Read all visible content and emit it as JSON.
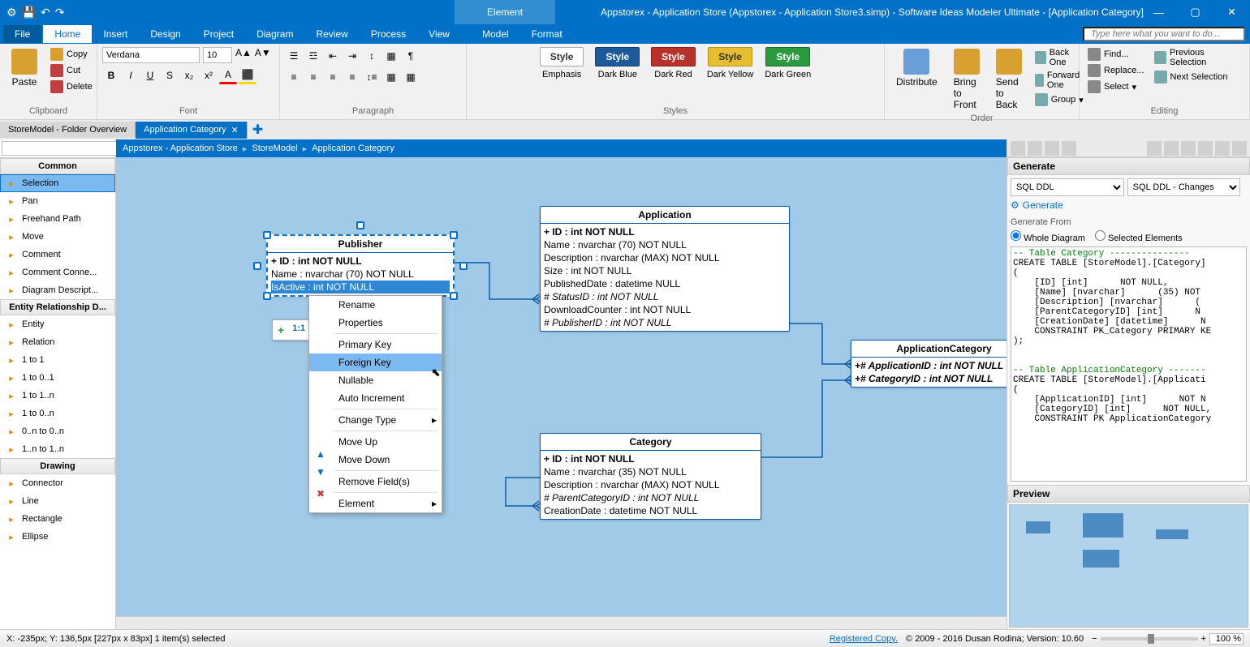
{
  "titlebar": {
    "context_tab": "Element",
    "title": "Appstorex - Application Store (Appstorex - Application Store3.simp)  - Software Ideas Modeler Ultimate - [Application Category]"
  },
  "menubar": {
    "file": "File",
    "tabs": [
      "Home",
      "Insert",
      "Design",
      "Project",
      "Diagram",
      "Review",
      "Process",
      "View",
      "Model",
      "Format"
    ],
    "active_tab": "Home",
    "search_placeholder": "Type here what you want to do..."
  },
  "ribbon": {
    "clipboard": {
      "paste": "Paste",
      "copy": "Copy",
      "cut": "Cut",
      "delete": "Delete",
      "label": "Clipboard"
    },
    "font": {
      "family": "Verdana",
      "size": "10",
      "label": "Font"
    },
    "paragraph": {
      "label": "Paragraph"
    },
    "styles": {
      "label": "Styles",
      "items": [
        {
          "name": "Emphasis",
          "btn": "Style",
          "bg": "#ffffff",
          "fg": "#333",
          "border": "#aaa"
        },
        {
          "name": "Dark Blue",
          "btn": "Style",
          "bg": "#1d5a9a",
          "fg": "#fff",
          "border": "#0e3f6f"
        },
        {
          "name": "Dark Red",
          "btn": "Style",
          "bg": "#b8312a",
          "fg": "#fff",
          "border": "#8a201a"
        },
        {
          "name": "Dark Yellow",
          "btn": "Style",
          "bg": "#e7bf2e",
          "fg": "#333",
          "border": "#b89218"
        },
        {
          "name": "Dark Green",
          "btn": "Style",
          "bg": "#2a9a3e",
          "fg": "#fff",
          "border": "#1a6e28"
        }
      ]
    },
    "order": {
      "label": "Order",
      "distribute": "Distribute",
      "bring_front": "Bring to Front",
      "send_back": "Send to Back",
      "back_one": "Back One",
      "forward_one": "Forward One",
      "group": "Group"
    },
    "editing": {
      "label": "Editing",
      "find": "Find...",
      "replace": "Replace...",
      "select": "Select",
      "prev_sel": "Previous Selection",
      "next_sel": "Next Selection"
    }
  },
  "doc_tabs": {
    "tab1": "StoreModel - Folder Overview",
    "tab2": "Application Category"
  },
  "breadcrumb": {
    "a": "Appstorex - Application Store",
    "b": "StoreModel",
    "c": "Application Category"
  },
  "left": {
    "cat_common": "Common",
    "common_items": [
      "Selection",
      "Pan",
      "Freehand Path",
      "Move",
      "Comment",
      "Comment Conne...",
      "Diagram Descript..."
    ],
    "cat_erd": "Entity Relationship D...",
    "erd_items": [
      "Entity",
      "Relation",
      "1 to 1",
      "1 to 0..1",
      "1 to 1..n",
      "1 to 0..n",
      "0..n to 0..n",
      "1..n to 1..n"
    ],
    "cat_drawing": "Drawing",
    "drawing_items": [
      "Connector",
      "Line",
      "Rectangle",
      "Ellipse"
    ]
  },
  "entities": {
    "publisher": {
      "name": "Publisher",
      "rows": [
        "+ ID : int NOT NULL",
        "Name : nvarchar (70)  NOT NULL",
        "IsActive : int NOT NULL"
      ]
    },
    "application": {
      "name": "Application",
      "rows": [
        "+ ID : int NOT NULL",
        "Name : nvarchar (70)  NOT NULL",
        "Description : nvarchar (MAX)  NOT NULL",
        "Size : int NOT NULL",
        "PublishedDate : datetime NULL",
        "# StatusID : int NOT NULL",
        "DownloadCounter : int NOT NULL",
        "# PublisherID : int NOT NULL"
      ],
      "italic_idx": [
        5,
        7
      ]
    },
    "appcat": {
      "name": "ApplicationCategory",
      "rows": [
        "+# ApplicationID : int NOT NULL",
        "+# CategoryID : int NOT NULL"
      ],
      "italic_idx": [
        0,
        1
      ]
    },
    "category": {
      "name": "Category",
      "rows": [
        "+ ID : int NOT NULL",
        "Name : nvarchar (35)  NOT NULL",
        "Description : nvarchar (MAX)  NOT NULL",
        "# ParentCategoryID : int NOT NULL",
        "CreationDate : datetime NOT NULL"
      ],
      "italic_idx": [
        3
      ]
    }
  },
  "ctx_menu": {
    "items": [
      "Rename",
      "Properties",
      "Primary Key",
      "Foreign Key",
      "Nullable",
      "Auto Increment",
      "Change Type",
      "Move Up",
      "Move Down",
      "Remove Field(s)",
      "Element"
    ],
    "hover": "Foreign Key",
    "submenu": [
      "Change Type",
      "Element"
    ]
  },
  "mini_toolbar": {
    "label": "1:1",
    "plus": "+"
  },
  "right": {
    "gen_header": "Generate",
    "sel1": "SQL DDL",
    "sel2": "SQL DDL - Changes",
    "gen_link": "Generate",
    "gen_from": "Generate From",
    "r1": "Whole Diagram",
    "r2": "Selected Elements",
    "sql": "-- Table Category ---------------\nCREATE TABLE [StoreModel].[Category]\n(\n    [ID] [int]      NOT NULL,\n    [Name] [nvarchar]      (35) NOT\n    [Description] [nvarchar]      (\n    [ParentCategoryID] [int]      N\n    [CreationDate] [datetime]      N\n    CONSTRAINT PK_Category PRIMARY KE\n);\n\n\n-- Table ApplicationCategory -------\nCREATE TABLE [StoreModel].[Applicati\n(\n    [ApplicationID] [int]      NOT N\n    [CategoryID] [int]      NOT NULL,\n    CONSTRAINT PK ApplicationCategory",
    "preview_header": "Preview"
  },
  "statusbar": {
    "left": "X: -235px; Y: 136,5px  [227px x 83px] 1 item(s) selected",
    "reg": "Registered Copy.",
    "copyright": "© 2009 - 2016 Dusan Rodina; Version: 10.60",
    "zoom": "100 %"
  }
}
